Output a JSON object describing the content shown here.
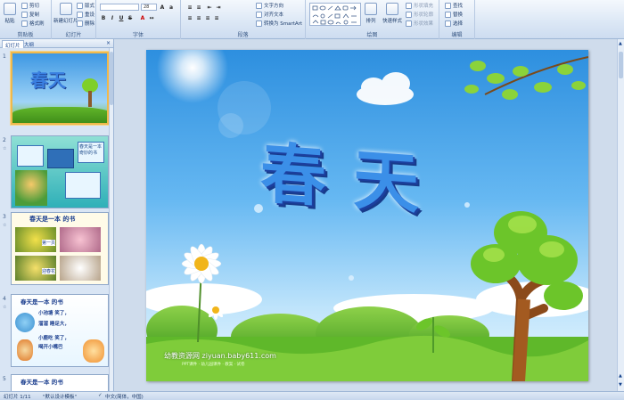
{
  "ribbon": {
    "clipboard": {
      "paste": "粘贴",
      "cut": "剪切",
      "copy": "复制",
      "format_painter": "格式刷",
      "label": "剪贴板"
    },
    "slides": {
      "new_slide": "新建幻灯片",
      "layout": "版式",
      "reset": "重设",
      "delete": "删除",
      "label": "幻灯片"
    },
    "font": {
      "font_size": "28",
      "label": "字体"
    },
    "paragraph": {
      "text_direction": "文字方向",
      "align_text": "对齐文本",
      "smartart": "转换为 SmartArt",
      "label": "段落"
    },
    "drawing": {
      "arrange": "排列",
      "quick_styles": "快速样式",
      "shape_fill": "形状填充",
      "shape_outline": "形状轮廓",
      "shape_effects": "形状效果",
      "label": "绘图"
    },
    "editing": {
      "find": "查找",
      "replace": "替换",
      "select": "选择",
      "label": "编辑"
    }
  },
  "left_pane": {
    "tabs": [
      "幻灯片",
      "大纲"
    ],
    "slides": [
      {
        "num": "1",
        "title": "春天"
      },
      {
        "num": "2",
        "title": "春天是一本奇妙的书"
      },
      {
        "num": "3",
        "title": "春天是一本    的书",
        "caption_a": "第一页",
        "caption_b": "迎春花"
      },
      {
        "num": "4",
        "title": "春天是一本    的书",
        "line1": "小池塘    笑了，",
        "line2": "溜溜    睡足大，",
        "line3": "小鹿吃    笑了，",
        "line4": "喝开小嘴巴"
      },
      {
        "num": "5",
        "title": "春天是一本    的书"
      }
    ]
  },
  "slide": {
    "title": "春天",
    "watermark": "幼教资源网 ziyuan.baby611.com",
    "watermark_sub": "PPT课件 · 幼儿园课件 · 教案 · 试卷"
  },
  "status": {
    "slide_count": "幻灯片 1/11",
    "theme": "\"默认设计模板\"",
    "language": "中文(简体，中国)"
  },
  "colors": {
    "accent": "#15428b",
    "selected_border": "#f0b94c",
    "slide_sky": "#66b8f2",
    "title_blue": "#2f72d8"
  }
}
